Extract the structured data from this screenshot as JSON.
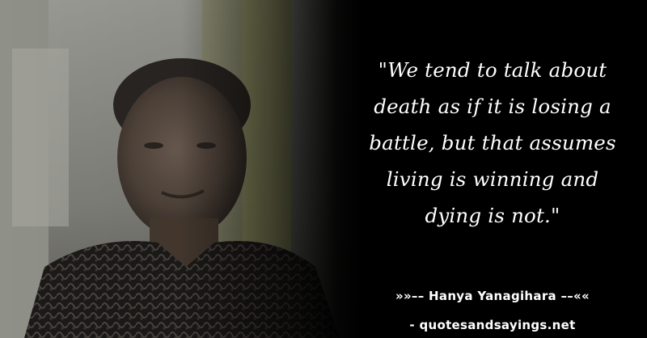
{
  "quote": {
    "lines": [
      "\"We tend to talk about",
      "death as if it is losing a",
      "battle, but that assumes",
      "living is winning and",
      "dying is not.\""
    ]
  },
  "attribution": {
    "author": "»»–– Hanya Yanagihara ––««",
    "source": "- quotesandsayings.net"
  },
  "colors": {
    "background": "#000000",
    "text": "#ffffff"
  }
}
